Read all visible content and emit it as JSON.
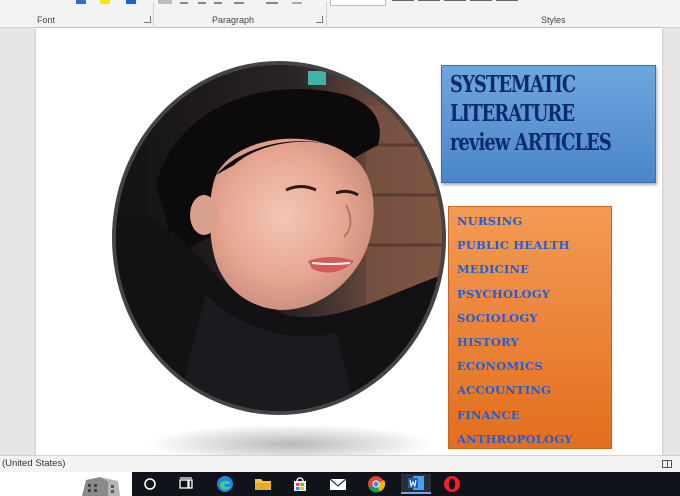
{
  "ribbon": {
    "groups": [
      {
        "label": "Font"
      },
      {
        "label": "Paragraph"
      },
      {
        "label": "Styles"
      }
    ]
  },
  "document": {
    "title_lines": [
      "SYSTEMATIC",
      "LITERATURE",
      "review ARTICLES"
    ],
    "subjects": [
      "NURSING",
      "PUBLIC HEALTH",
      "MEDICINE",
      "PSYCHOLOGY",
      "SOCIOLOGY",
      "HISTORY",
      "ECONOMICS",
      "ACCOUNTING",
      "FINANCE",
      "ANTHROPOLOGY"
    ]
  },
  "status_bar": {
    "language": "(United States)"
  },
  "taskbar": {
    "icons": [
      "cortana-icon",
      "task-view-icon",
      "edge-icon",
      "file-explorer-icon",
      "store-icon",
      "mail-icon",
      "chrome-icon",
      "word-icon",
      "opera-icon"
    ]
  },
  "colors": {
    "title_box": "#4a86c8",
    "title_text": "#0e2a6e",
    "list_box": "#e36e1d",
    "list_text": "#1f5fd6",
    "taskbar": "#10131a"
  }
}
